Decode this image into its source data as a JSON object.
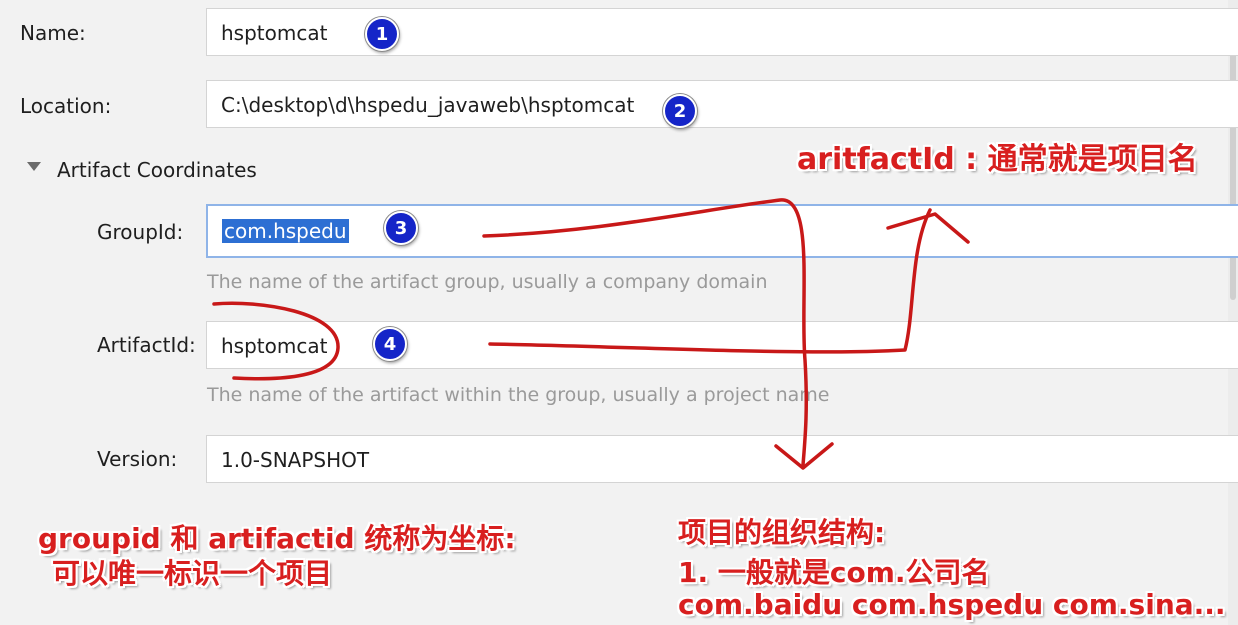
{
  "form": {
    "name": {
      "label": "Name:",
      "value": "hsptomcat"
    },
    "location": {
      "label": "Location:",
      "value": "C:\\desktop\\d\\hspedu_javaweb\\hsptomcat"
    },
    "section": {
      "label": "Artifact Coordinates"
    },
    "group_id": {
      "label": "GroupId:",
      "value": "com.hspedu",
      "hint": "The name of the artifact group, usually a company domain"
    },
    "artifact_id": {
      "label": "ArtifactId:",
      "value": "hsptomcat",
      "hint": "The name of the artifact within the group, usually a project name"
    },
    "version": {
      "label": "Version:",
      "value": "1.0-SNAPSHOT"
    }
  },
  "badges": [
    "1",
    "2",
    "3",
    "4"
  ],
  "annotations": {
    "artifact_note": "aritfactId : 通常就是项目名",
    "coordinate_note_line1": "groupid 和 artifactid 统称为坐标:",
    "coordinate_note_line2": "可以唯一标识一个项目",
    "structure_title": "项目的组织结构:",
    "structure_line1": "1. 一般就是com.公司名",
    "structure_line2": "com.baidu com.hspedu com.sina..."
  },
  "colors": {
    "annotation_red": "#d81f1f",
    "badge_blue": "#1525c8",
    "selection_blue": "#2d6fd3",
    "focus_border": "#8fb4e8"
  }
}
